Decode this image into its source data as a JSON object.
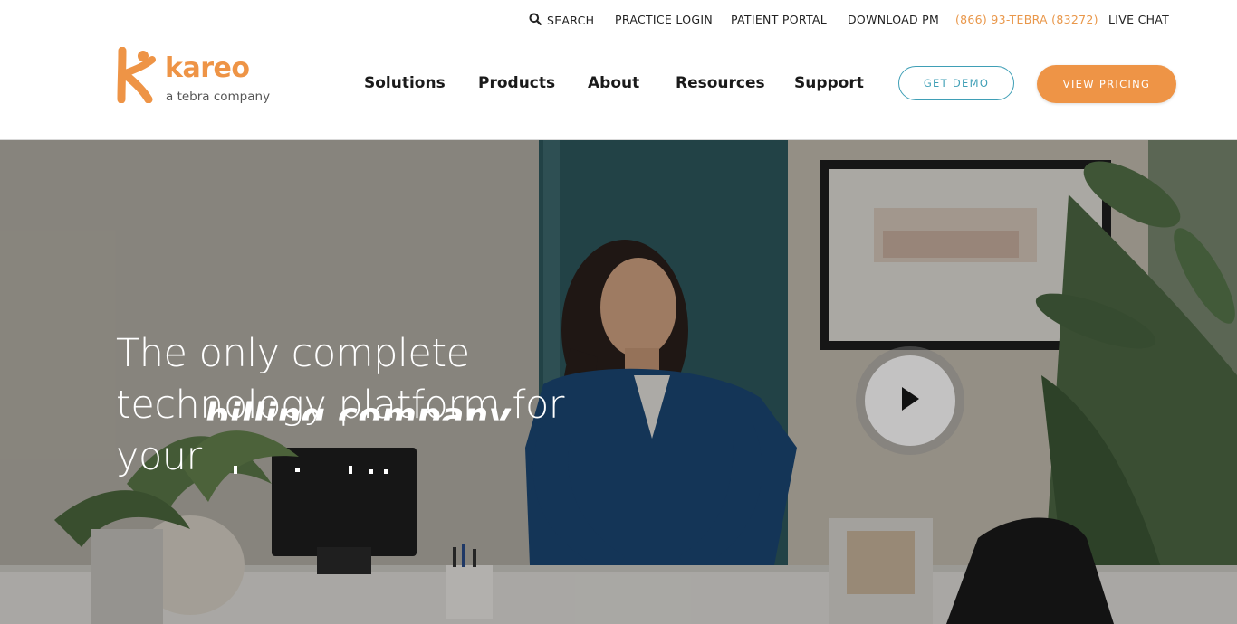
{
  "utility_nav": {
    "search_label": "SEARCH",
    "practice_login": "PRACTICE LOGIN",
    "patient_portal": "PATIENT PORTAL",
    "download_pm": "DOWNLOAD PM",
    "phone": "(866) 93-TEBRA (83272)",
    "live_chat": "LIVE CHAT"
  },
  "brand": {
    "name": "kareo",
    "tagline": "a tebra company",
    "accent_color": "#ee9446",
    "secondary_color": "#3f9fb6"
  },
  "main_nav": {
    "items": [
      "Solutions",
      "Products",
      "About",
      "Resources",
      "Support"
    ]
  },
  "cta": {
    "demo": "GET DEMO",
    "pricing": "VIEW PRICING"
  },
  "hero": {
    "headline_lines": [
      "The only complete",
      "technology platform for",
      "your"
    ],
    "rotating_word": "billing company",
    "play_icon": "play-icon"
  }
}
